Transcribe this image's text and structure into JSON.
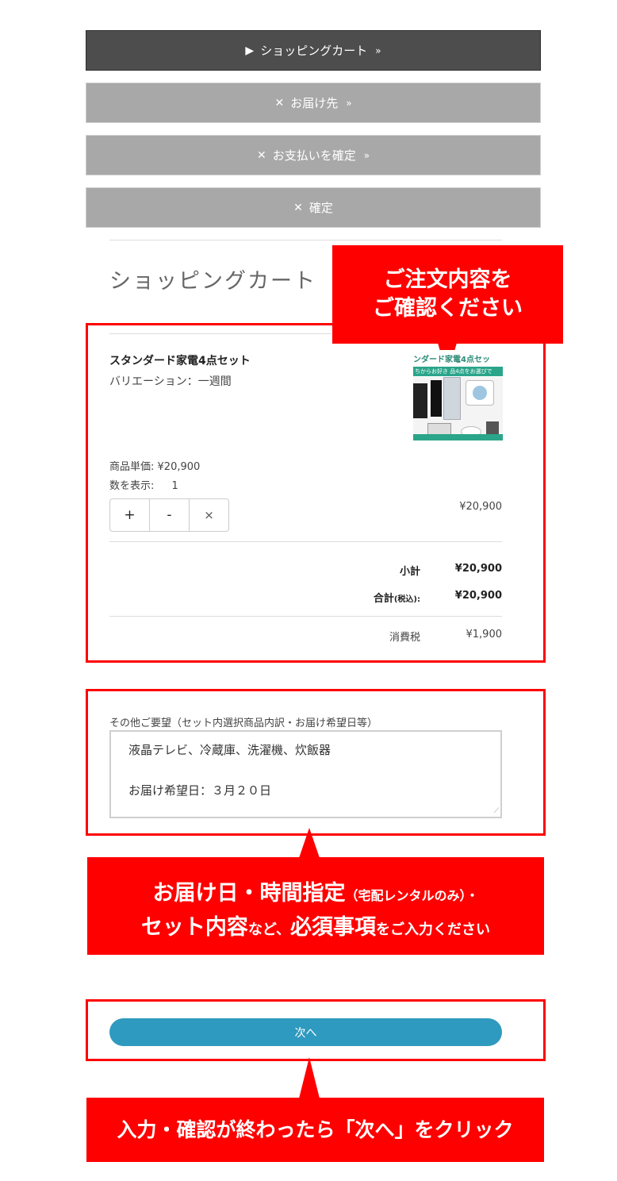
{
  "steps": [
    {
      "glyph": "▶",
      "label": "ショッピングカート",
      "suffix": "»"
    },
    {
      "glyph": "✕",
      "label": "お届け先",
      "suffix": "»"
    },
    {
      "glyph": "✕",
      "label": "お支払いを確定",
      "suffix": "»"
    },
    {
      "glyph": "✕",
      "label": "確定",
      "suffix": ""
    }
  ],
  "page_title": "ショッピングカート",
  "callouts": {
    "confirm_line1": "ご注文内容を",
    "confirm_line2": "ご確認ください",
    "required_line1_big": "お届け日・時間指定",
    "required_line1_small": "（宅配レンタルのみ）・",
    "required_line2_big1": "セット内容",
    "required_line2_small1": "など、",
    "required_line2_big2": "必須事項",
    "required_line2_small2": "をご入力ください",
    "next_instruction": "入力・確認が終わったら「次へ」をクリック"
  },
  "product": {
    "name": "スタンダード家電4点セット",
    "variation": "バリエーション：一週間",
    "image_banner_line1": "ンダード家電4点セッ",
    "image_banner_line2": "ちからお好き 品4点をお選びで",
    "unit_price_label": "商品単価:",
    "unit_price": "¥20,900",
    "qty_label": "数を表示:",
    "qty": "1",
    "line_total": "¥20,900",
    "qty_buttons": {
      "plus": "+",
      "minus": "-",
      "remove": "×"
    }
  },
  "totals": {
    "subtotal_label": "小計",
    "subtotal": "¥20,900",
    "total_label": "合計",
    "total_label_small": "(税込):",
    "total": "¥20,900",
    "tax_label": "消費税",
    "tax": "¥1,900"
  },
  "notes": {
    "label": "その他ご要望（セット内選択商品内訳・お届け希望日等）",
    "line1": "液晶テレビ、冷蔵庫、洗濯機、炊飯器",
    "line2": "お届け希望日：３月２０日"
  },
  "next_button": "次へ",
  "colors": {
    "accent_red": "#ff0000",
    "next_button": "#2f9abf",
    "active_step": "#4d4d4d",
    "inactive_step": "#a8a8a8"
  }
}
